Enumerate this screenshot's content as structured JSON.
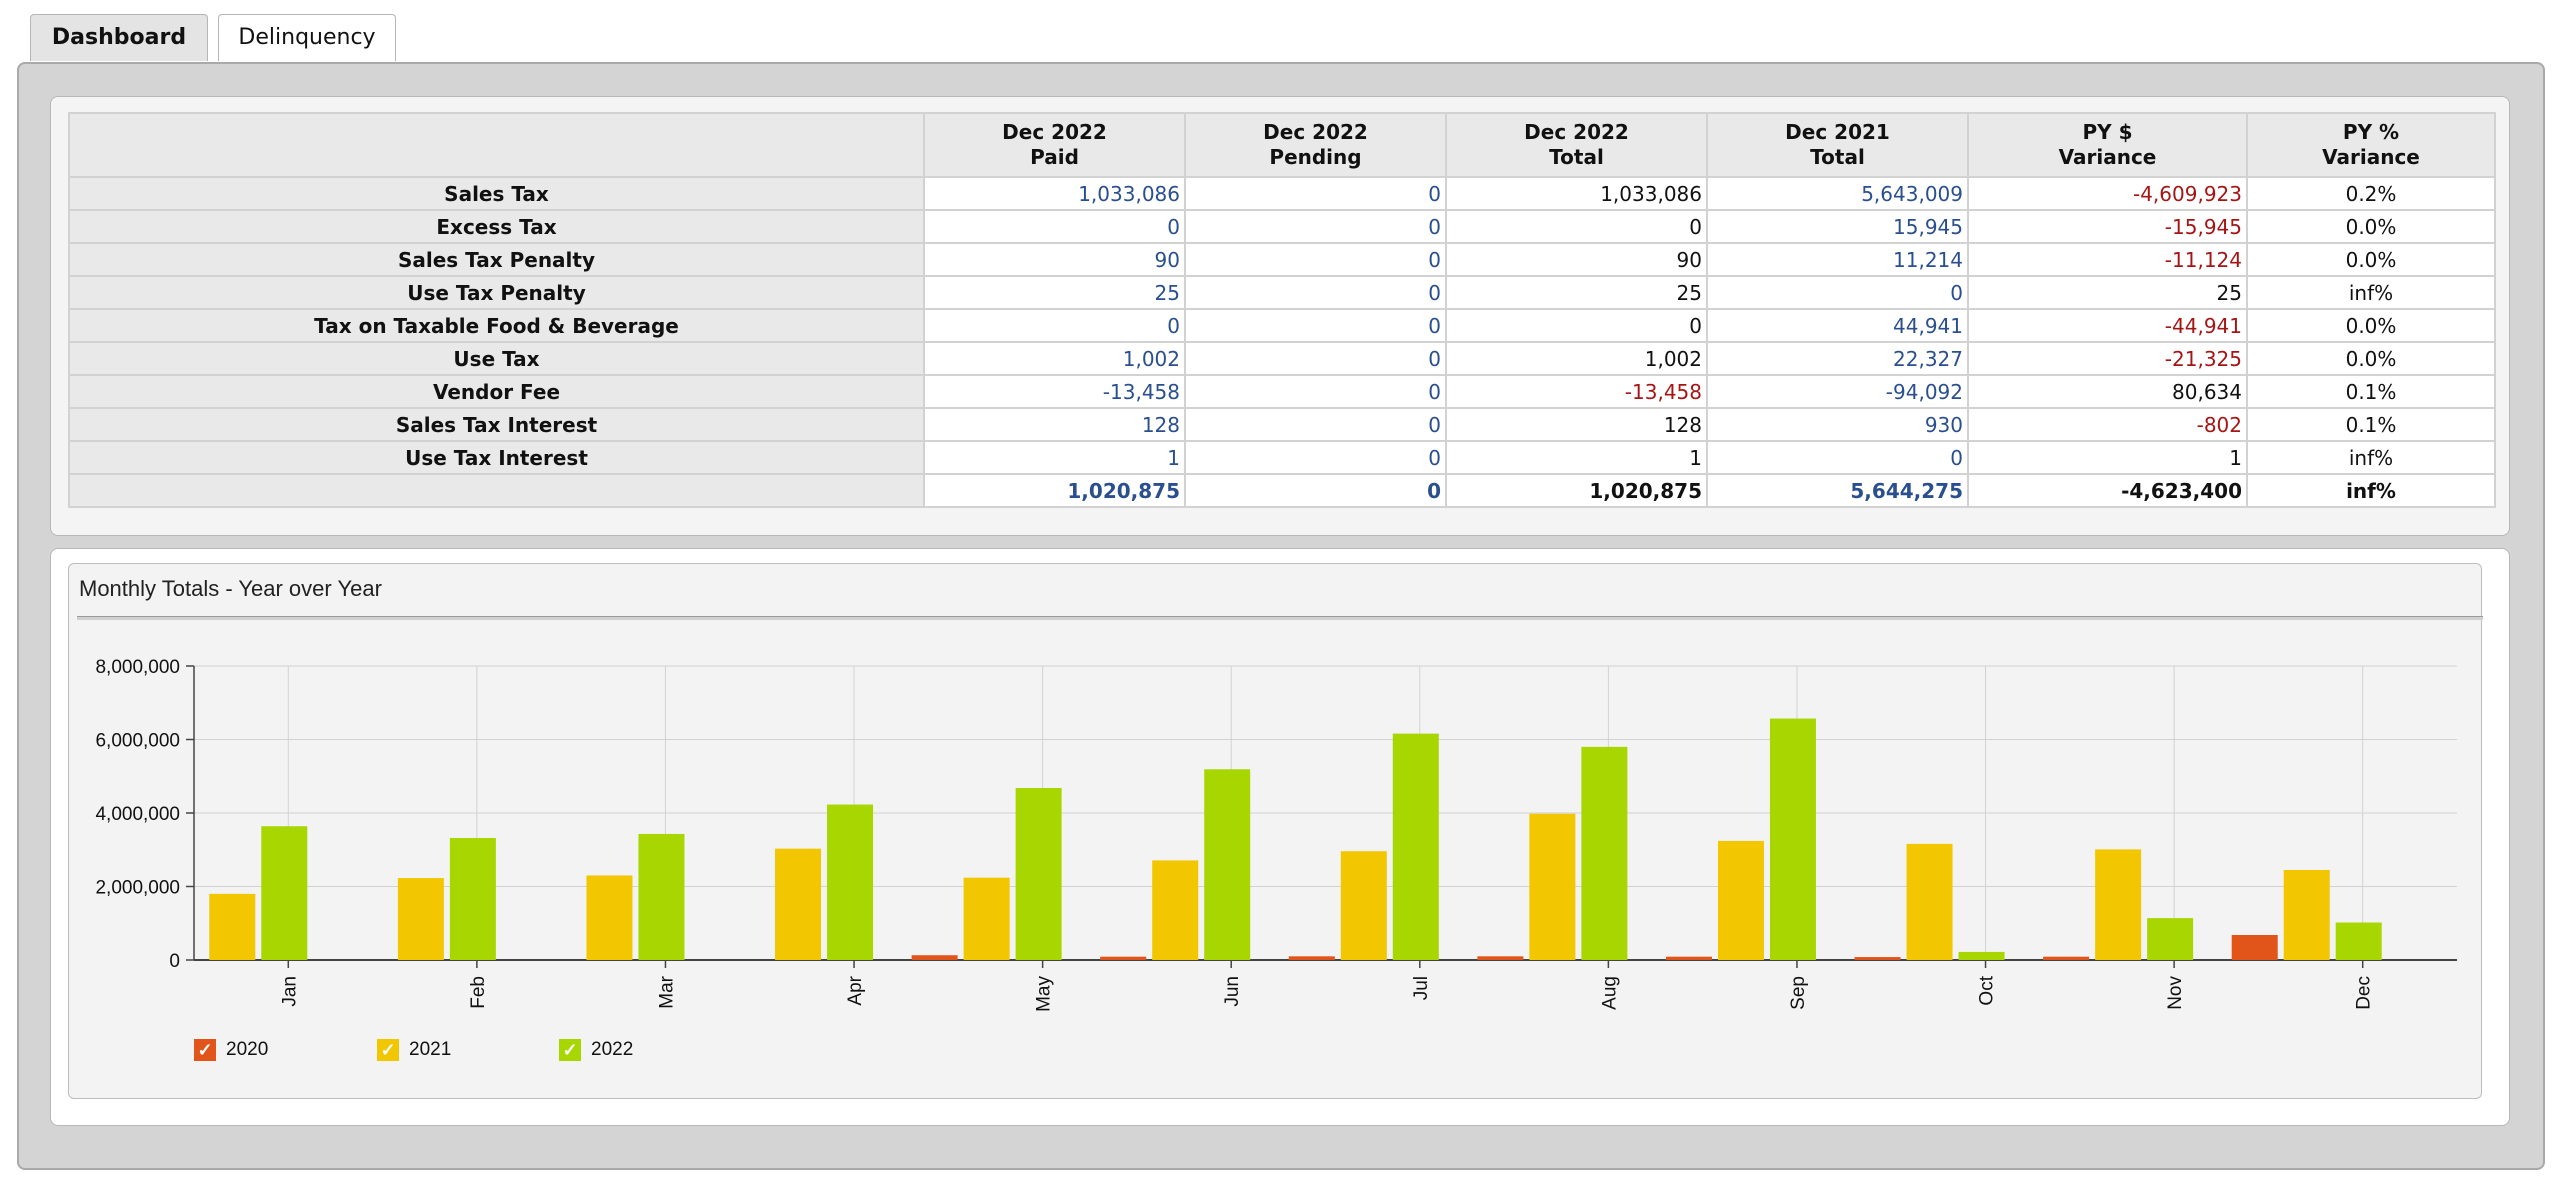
{
  "tabs": [
    {
      "label": "Dashboard",
      "active": true
    },
    {
      "label": "Delinquency",
      "active": false
    }
  ],
  "table": {
    "headers": [
      "",
      "Dec 2022\nPaid",
      "Dec 2022\nPending",
      "Dec 2022\nTotal",
      "Dec 2021\nTotal",
      "PY $\nVariance",
      "PY %\nVariance"
    ],
    "rows": [
      {
        "label": "Sales Tax",
        "cells": [
          "1,033,086",
          "0",
          "1,033,086",
          "5,643,009",
          "-4,609,923",
          "0.2%"
        ],
        "colors": [
          "blue",
          "blue",
          "black",
          "blue",
          "red",
          "black"
        ]
      },
      {
        "label": "Excess Tax",
        "cells": [
          "0",
          "0",
          "0",
          "15,945",
          "-15,945",
          "0.0%"
        ],
        "colors": [
          "blue",
          "blue",
          "black",
          "blue",
          "red",
          "black"
        ]
      },
      {
        "label": "Sales Tax Penalty",
        "cells": [
          "90",
          "0",
          "90",
          "11,214",
          "-11,124",
          "0.0%"
        ],
        "colors": [
          "blue",
          "blue",
          "black",
          "blue",
          "red",
          "black"
        ]
      },
      {
        "label": "Use Tax Penalty",
        "cells": [
          "25",
          "0",
          "25",
          "0",
          "25",
          "inf%"
        ],
        "colors": [
          "blue",
          "blue",
          "black",
          "blue",
          "black",
          "black"
        ]
      },
      {
        "label": "Tax on Taxable Food & Beverage",
        "cells": [
          "0",
          "0",
          "0",
          "44,941",
          "-44,941",
          "0.0%"
        ],
        "colors": [
          "blue",
          "blue",
          "black",
          "blue",
          "red",
          "black"
        ]
      },
      {
        "label": "Use Tax",
        "cells": [
          "1,002",
          "0",
          "1,002",
          "22,327",
          "-21,325",
          "0.0%"
        ],
        "colors": [
          "blue",
          "blue",
          "black",
          "blue",
          "red",
          "black"
        ]
      },
      {
        "label": "Vendor Fee",
        "cells": [
          "-13,458",
          "0",
          "-13,458",
          "-94,092",
          "80,634",
          "0.1%"
        ],
        "colors": [
          "blue",
          "blue",
          "red",
          "blue",
          "black",
          "black"
        ]
      },
      {
        "label": "Sales Tax Interest",
        "cells": [
          "128",
          "0",
          "128",
          "930",
          "-802",
          "0.1%"
        ],
        "colors": [
          "blue",
          "blue",
          "black",
          "blue",
          "red",
          "black"
        ]
      },
      {
        "label": "Use Tax Interest",
        "cells": [
          "1",
          "0",
          "1",
          "0",
          "1",
          "inf%"
        ],
        "colors": [
          "blue",
          "blue",
          "black",
          "blue",
          "black",
          "black"
        ]
      },
      {
        "label": "",
        "cells": [
          "1,020,875",
          "0",
          "1,020,875",
          "5,644,275",
          "-4,623,400",
          "inf%"
        ],
        "colors": [
          "blue",
          "blue",
          "black",
          "blue",
          "black",
          "black"
        ],
        "total": true
      }
    ]
  },
  "chart": {
    "title": "Monthly Totals - Year over Year"
  },
  "chart_data": {
    "type": "bar",
    "title": "Monthly Totals - Year over Year",
    "categories": [
      "Jan",
      "Feb",
      "Mar",
      "Apr",
      "May",
      "Jun",
      "Jul",
      "Aug",
      "Sep",
      "Oct",
      "Nov",
      "Dec"
    ],
    "ylim": [
      0,
      8000000
    ],
    "yticks": [
      0,
      2000000,
      4000000,
      6000000,
      8000000
    ],
    "ytick_labels": [
      "0",
      "2,000,000",
      "4,000,000",
      "6,000,000",
      "8,000,000"
    ],
    "grid": true,
    "legend_position": "bottom-left",
    "series": [
      {
        "name": "2020",
        "color": "#e1541a",
        "values": [
          0,
          0,
          0,
          0,
          130000,
          90000,
          100000,
          100000,
          90000,
          80000,
          90000,
          680000
        ]
      },
      {
        "name": "2021",
        "color": "#f2c600",
        "values": [
          1800000,
          2230000,
          2300000,
          3030000,
          2240000,
          2710000,
          2960000,
          3980000,
          3240000,
          3160000,
          3010000,
          2450000
        ]
      },
      {
        "name": "2022",
        "color": "#a8d600",
        "values": [
          3640000,
          3320000,
          3430000,
          4230000,
          4680000,
          5190000,
          6160000,
          5800000,
          6570000,
          220000,
          1140000,
          1020000
        ]
      }
    ]
  }
}
